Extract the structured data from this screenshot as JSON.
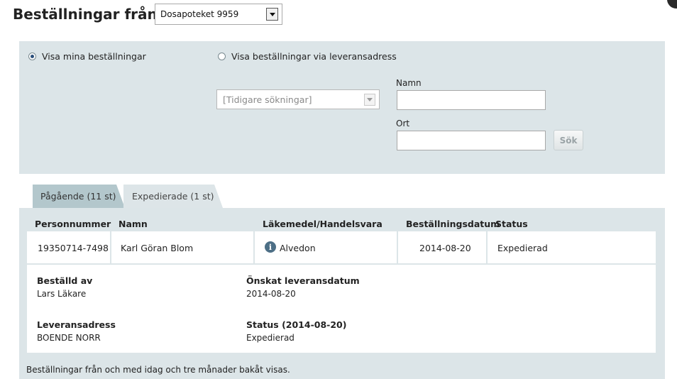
{
  "header": {
    "title": "Beställningar från",
    "pharmacy_select": {
      "selected": "Dosapoteket 9959"
    }
  },
  "search": {
    "radio_mine": {
      "label": "Visa mina beställningar",
      "checked": true
    },
    "radio_address": {
      "label": "Visa beställningar via leveransadress",
      "checked": false
    },
    "previous_searches": {
      "placeholder": "[Tidigare sökningar]"
    },
    "name_label": "Namn",
    "name_value": "",
    "city_label": "Ort",
    "city_value": "",
    "search_button": "Sök"
  },
  "tabs": [
    {
      "label": "Pågående (11 st)",
      "active": true
    },
    {
      "label": "Expedierade (1 st)",
      "active": false
    }
  ],
  "table": {
    "columns": [
      "Personnummer",
      "Namn",
      "Läkemedel/Handelsvara",
      "Beställningsdatum",
      "Status"
    ],
    "rows": [
      {
        "personnummer": "19350714-7498",
        "namn": "Karl Göran Blom",
        "lakemedel": "Alvedon",
        "bestallningsdatum": "2014-08-20",
        "status": "Expedierad"
      }
    ]
  },
  "details": {
    "ordered_by_label": "Beställd av",
    "ordered_by_value": "Lars Läkare",
    "desired_date_label": "Önskat leveransdatum",
    "desired_date_value": "2014-08-20",
    "address_label": "Leveransadress",
    "address_value": "BOENDE NORR",
    "status_label": "Status (2014-08-20)",
    "status_value": "Expedierad"
  },
  "footer": {
    "note": "Beställningar från och med idag och tre månader bakåt visas."
  },
  "icons": {
    "info": "info-icon",
    "dropdown": "chevron-down-icon"
  },
  "colors": {
    "panel_bg": "#dce5e8",
    "tab_active_bg": "#b3c7cc",
    "info_icon": "#4d6f86"
  }
}
